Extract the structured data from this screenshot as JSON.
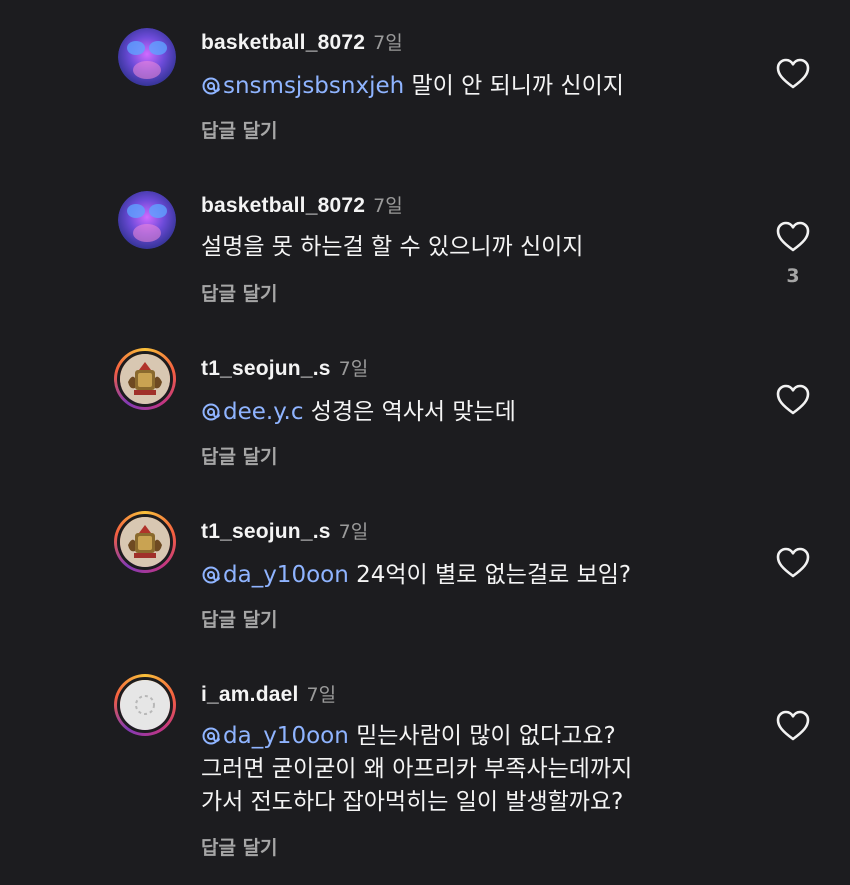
{
  "comments": [
    {
      "username": "basketball_8072",
      "time": "7일",
      "mention": "snsmsjsbsnxjeh",
      "text_lines": [
        " 말이 안 되니까 신이지"
      ],
      "reply_label": "답글 달기",
      "like_count": ""
    },
    {
      "username": "basketball_8072",
      "time": "7일",
      "mention": "",
      "text_lines": [
        "설명을 못 하는걸 할 수 있으니까 신이지"
      ],
      "reply_label": "답글 달기",
      "like_count": "3"
    },
    {
      "username": "t1_seojun_.s",
      "time": "7일",
      "mention": "dee.y.c",
      "text_lines": [
        " 성경은 역사서 맞는데"
      ],
      "reply_label": "답글 달기",
      "like_count": ""
    },
    {
      "username": "t1_seojun_.s",
      "time": "7일",
      "mention": "da_y10oon",
      "text_lines": [
        " 24억이 별로 없는걸로 보임?"
      ],
      "reply_label": "답글 달기",
      "like_count": ""
    },
    {
      "username": "i_am.dael",
      "time": "7일",
      "mention": "da_y10oon",
      "text_lines": [
        " 믿는사람이 많이 없다고요?",
        "그러면 굳이굳이 왜 아프리카 부족사는데까지",
        "가서 전도하다 잡아먹히는 일이 발생할까요?"
      ],
      "reply_label": "답글 달기",
      "like_count": ""
    }
  ],
  "colors": {
    "background": "#1c1c1f",
    "mention": "#8fb4ff",
    "muted": "#a6a6a6"
  },
  "icons": {
    "like": "heart-outline-icon",
    "mention": "threads-at-icon"
  }
}
